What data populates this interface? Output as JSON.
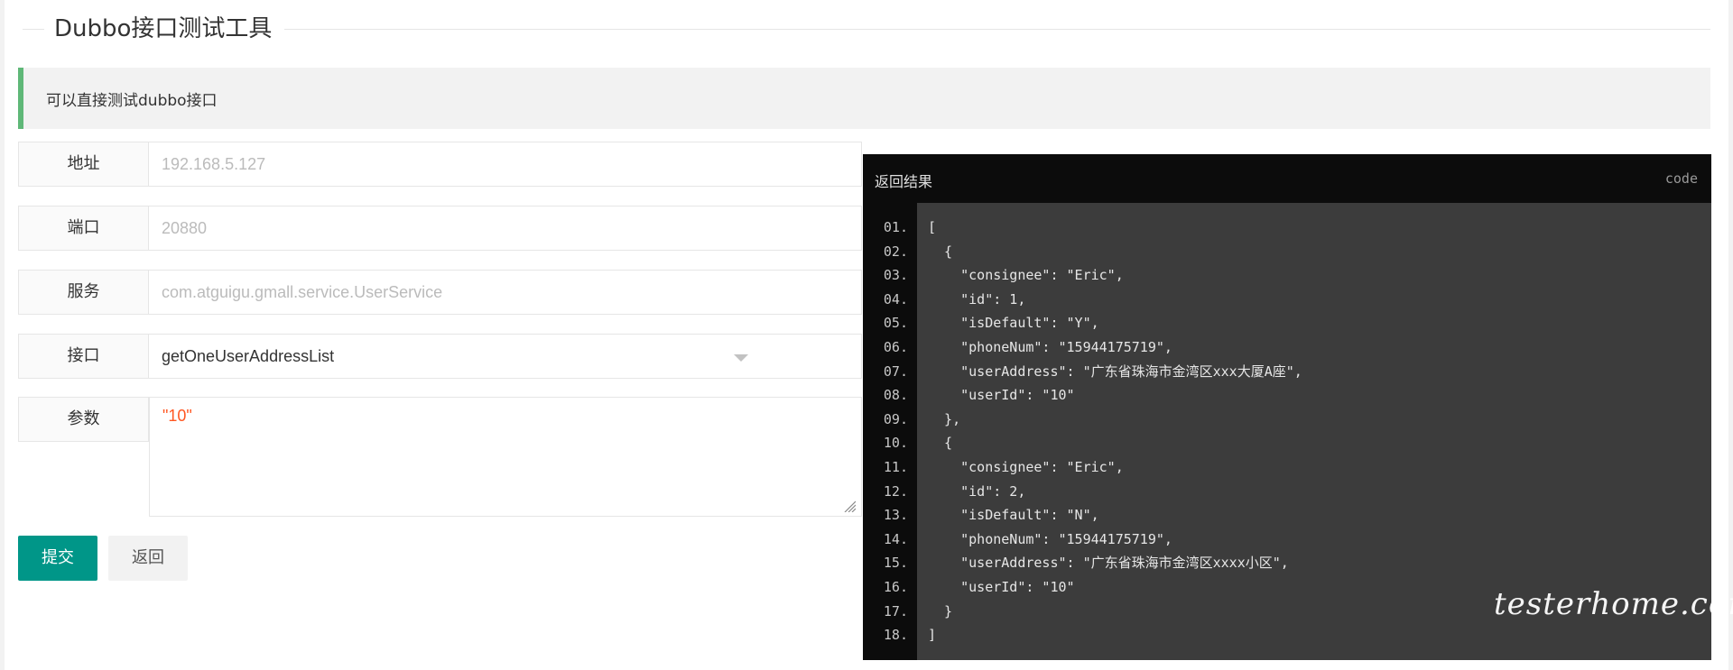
{
  "page": {
    "title": "Dubbo接口测试工具",
    "notice": "可以直接测试dubbo接口"
  },
  "form": {
    "address": {
      "label": "地址",
      "placeholder": "192.168.5.127"
    },
    "port": {
      "label": "端口",
      "placeholder": "20880"
    },
    "service": {
      "label": "服务",
      "placeholder": "com.atguigu.gmall.service.UserService"
    },
    "method": {
      "label": "接口",
      "value": "getOneUserAddressList"
    },
    "params": {
      "label": "参数",
      "value": "\"10\""
    },
    "submit_label": "提交",
    "back_label": "返回"
  },
  "result": {
    "title": "返回结果",
    "tag": "code",
    "lines": [
      {
        "num": "01.",
        "text": "["
      },
      {
        "num": "02.",
        "text": "  {"
      },
      {
        "num": "03.",
        "text": "    \"consignee\": \"Eric\","
      },
      {
        "num": "04.",
        "text": "    \"id\": 1,"
      },
      {
        "num": "05.",
        "text": "    \"isDefault\": \"Y\","
      },
      {
        "num": "06.",
        "text": "    \"phoneNum\": \"15944175719\","
      },
      {
        "num": "07.",
        "text": "    \"userAddress\": \"广东省珠海市金湾区xxx大厦A座\","
      },
      {
        "num": "08.",
        "text": "    \"userId\": \"10\""
      },
      {
        "num": "09.",
        "text": "  },"
      },
      {
        "num": "10.",
        "text": "  {"
      },
      {
        "num": "11.",
        "text": "    \"consignee\": \"Eric\","
      },
      {
        "num": "12.",
        "text": "    \"id\": 2,"
      },
      {
        "num": "13.",
        "text": "    \"isDefault\": \"N\","
      },
      {
        "num": "14.",
        "text": "    \"phoneNum\": \"15944175719\","
      },
      {
        "num": "15.",
        "text": "    \"userAddress\": \"广东省珠海市金湾区xxxx小区\","
      },
      {
        "num": "16.",
        "text": "    \"userId\": \"10\""
      },
      {
        "num": "17.",
        "text": "  }"
      },
      {
        "num": "18.",
        "text": "]"
      }
    ]
  },
  "watermark": "testerhome.com",
  "colors": {
    "accent": "#009688",
    "notice_border": "#5fb878",
    "param_text": "#ff5722",
    "code_bg": "#3c3c3c",
    "code_header_bg": "#0c0c0c"
  }
}
